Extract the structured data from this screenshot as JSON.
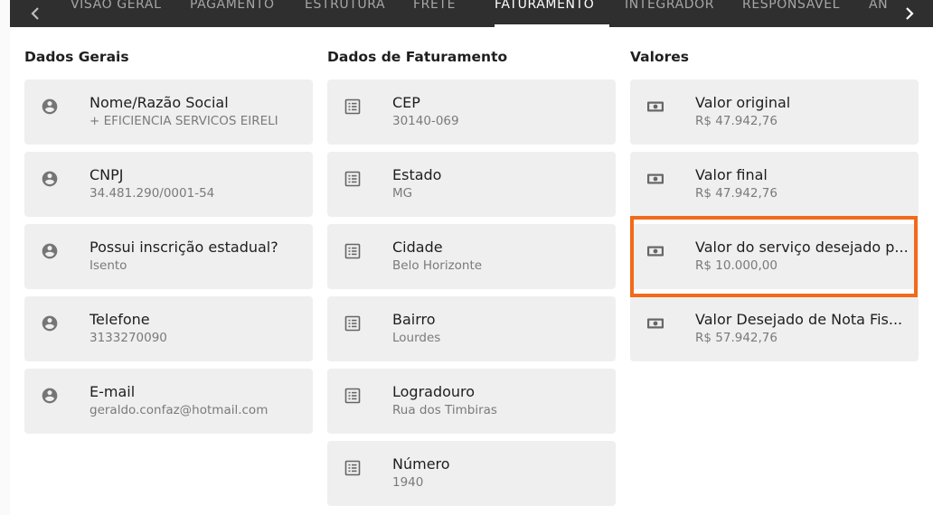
{
  "tabs": [
    {
      "label": "VISAO GERAL",
      "active": false
    },
    {
      "label": "PAGAMENTO",
      "active": false
    },
    {
      "label": "ESTRUTURA",
      "active": false
    },
    {
      "label": "FRETE",
      "active": false
    },
    {
      "label": "FATURAMENTO",
      "active": true
    },
    {
      "label": "INTEGRADOR",
      "active": false
    },
    {
      "label": "RESPONSAVEL",
      "active": false
    },
    {
      "label": "AN",
      "active": false
    }
  ],
  "colors": {
    "tabbar_bg": "#2f2f2f",
    "card_bg": "#efefef",
    "highlight": "#f26a1b"
  },
  "columns": [
    {
      "title": "Dados Gerais",
      "icon": "account-circle-icon",
      "items": [
        {
          "label": "Nome/Razão Social",
          "value": "+ EFICIENCIA SERVICOS EIRELI"
        },
        {
          "label": "CNPJ",
          "value": "34.481.290/0001-54"
        },
        {
          "label": "Possui inscrição estadual?",
          "value": "Isento"
        },
        {
          "label": "Telefone",
          "value": "3133270090"
        },
        {
          "label": "E-mail",
          "value": "geraldo.confaz@hotmail.com"
        }
      ]
    },
    {
      "title": "Dados de Faturamento",
      "icon": "list-icon",
      "items": [
        {
          "label": "CEP",
          "value": "30140-069"
        },
        {
          "label": "Estado",
          "value": "MG"
        },
        {
          "label": "Cidade",
          "value": "Belo Horizonte"
        },
        {
          "label": "Bairro",
          "value": "Lourdes"
        },
        {
          "label": "Logradouro",
          "value": "Rua dos Timbiras"
        },
        {
          "label": "Número",
          "value": "1940"
        }
      ]
    },
    {
      "title": "Valores",
      "icon": "money-icon",
      "items": [
        {
          "label": "Valor original",
          "value": "R$ 47.942,76"
        },
        {
          "label": "Valor final",
          "value": "R$ 47.942,76"
        },
        {
          "label": "Valor do serviço desejado p...",
          "value": "R$ 10.000,00"
        },
        {
          "label": "Valor Desejado de Nota Fis...",
          "value": "R$ 57.942,76"
        }
      ]
    }
  ]
}
